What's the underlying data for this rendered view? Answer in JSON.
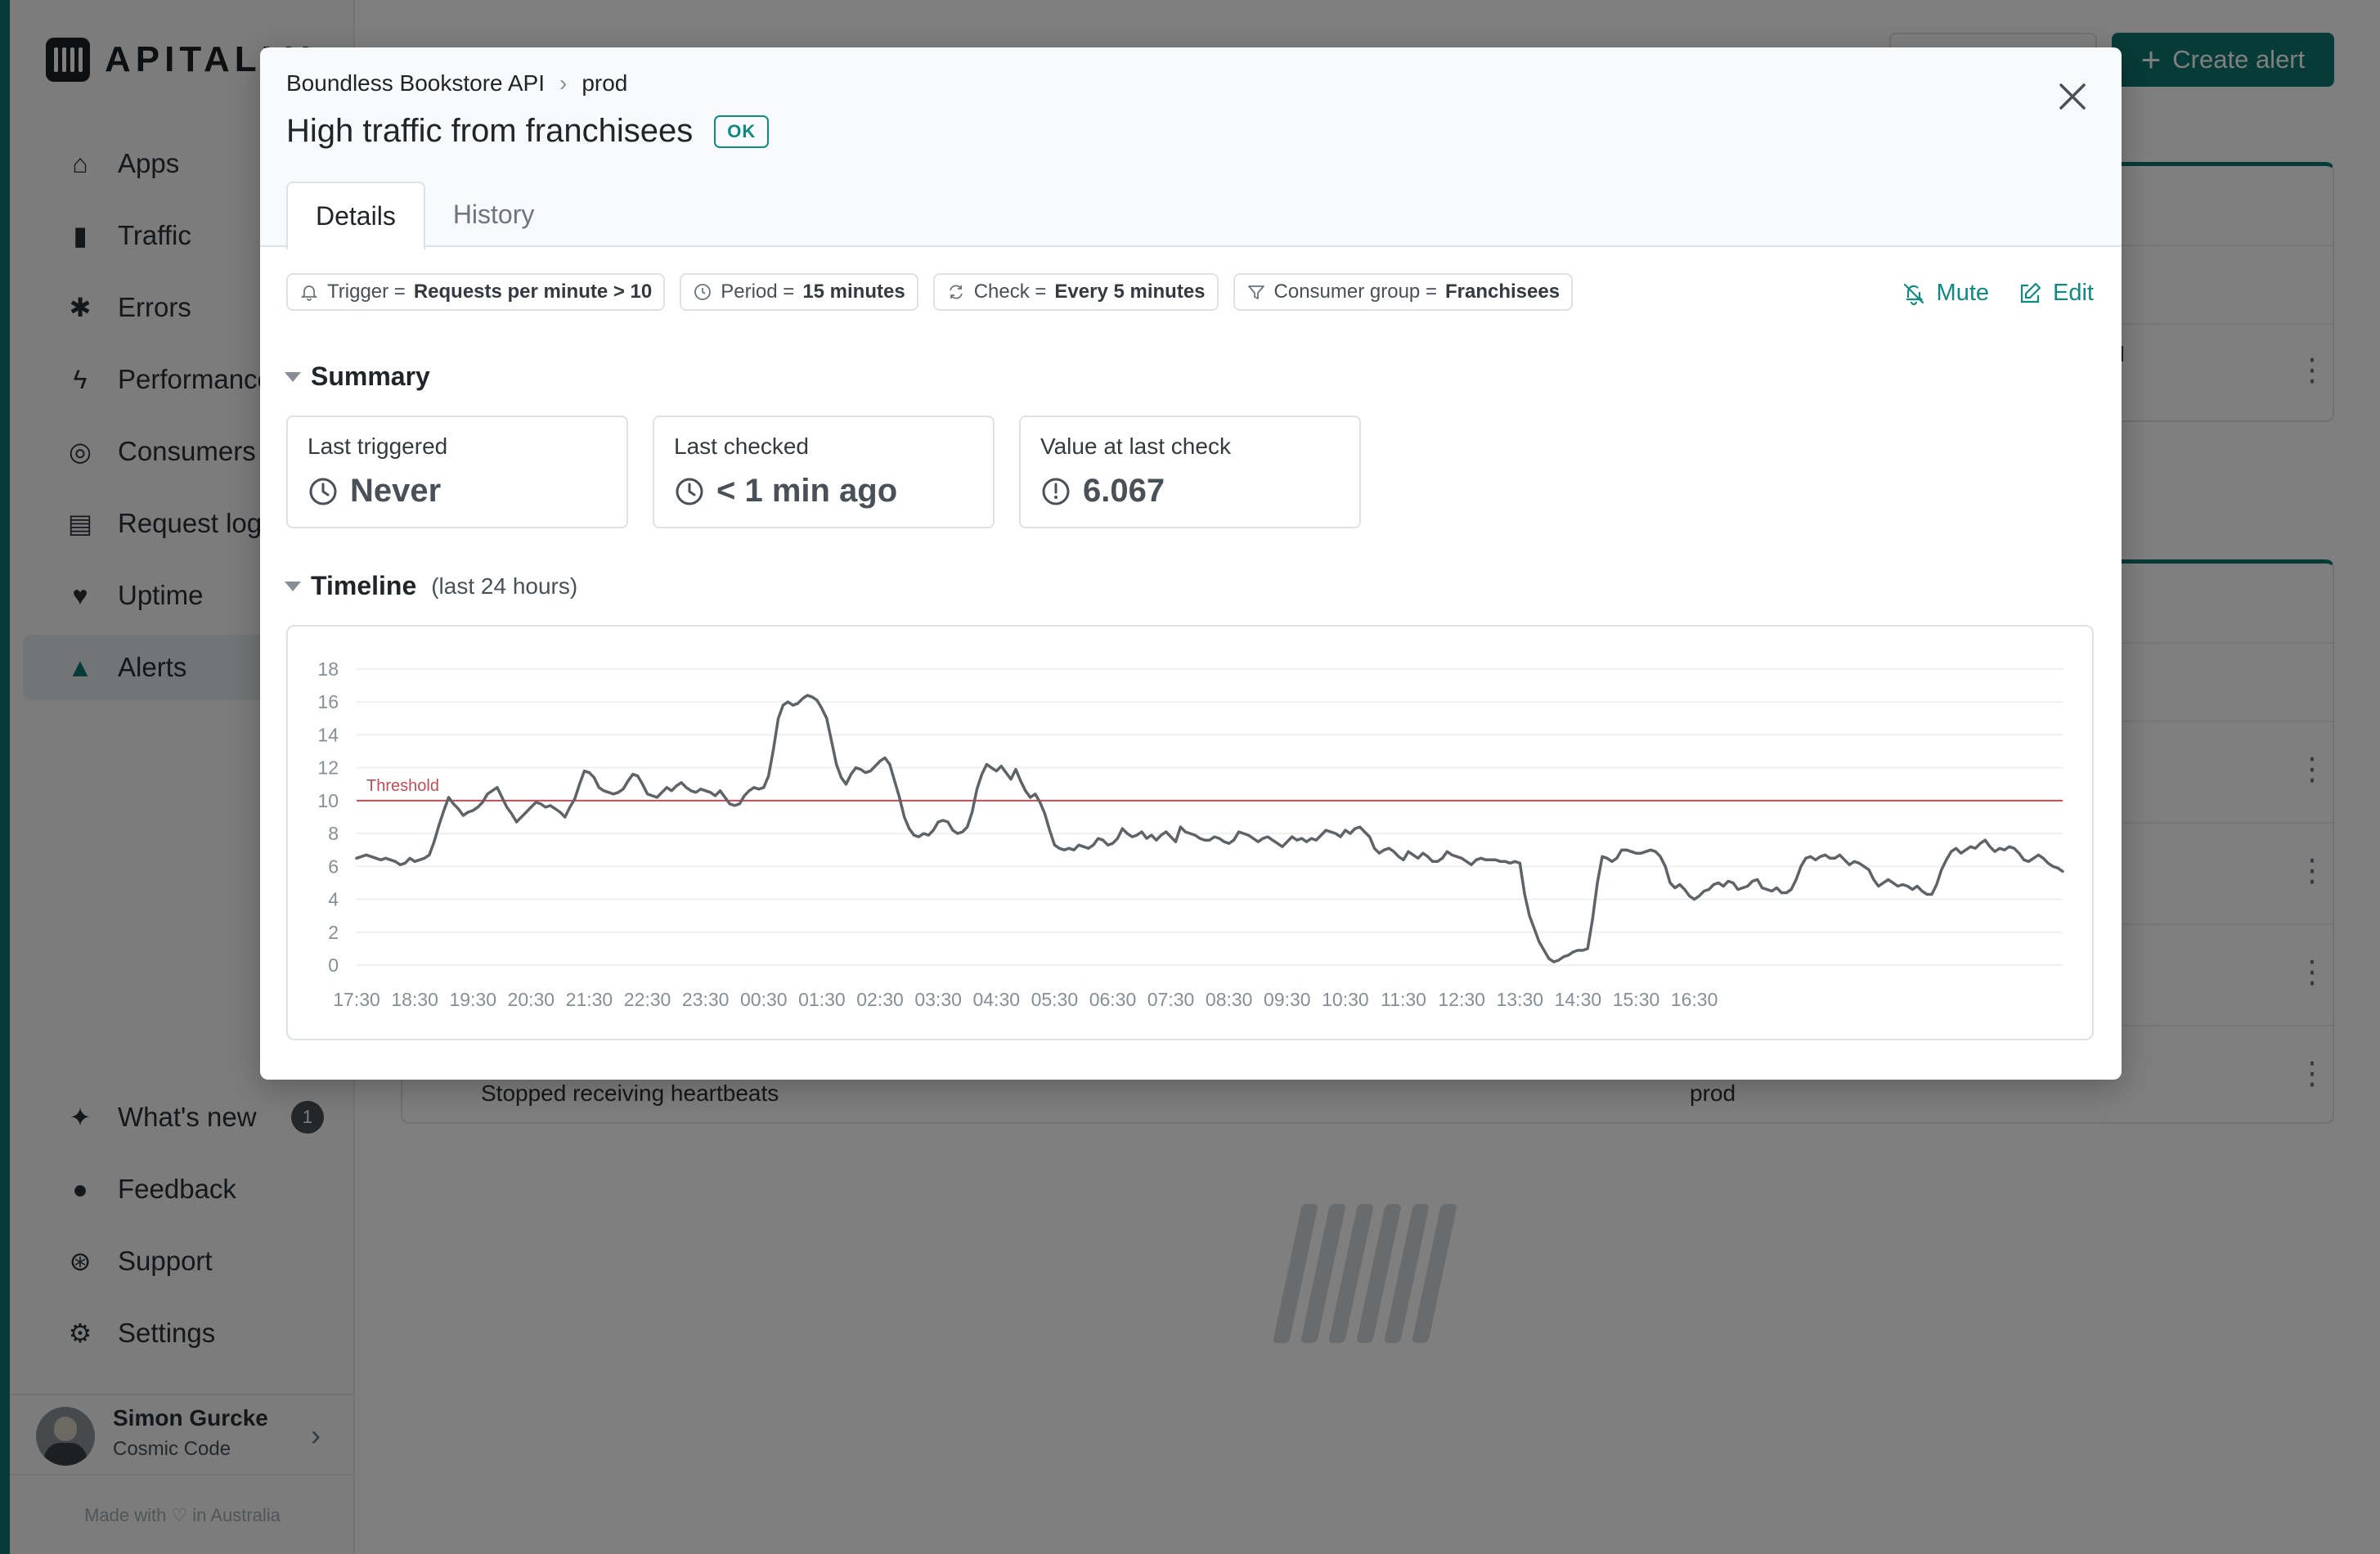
{
  "app": {
    "logo_text": "APITALLY",
    "nav": [
      {
        "label": "Apps",
        "icon": "home-icon"
      },
      {
        "label": "Traffic",
        "icon": "bar-chart-icon"
      },
      {
        "label": "Errors",
        "icon": "bug-icon"
      },
      {
        "label": "Performance",
        "icon": "bolt-icon"
      },
      {
        "label": "Consumers",
        "icon": "fingerprint-icon"
      },
      {
        "label": "Request log",
        "icon": "scroll-icon"
      },
      {
        "label": "Uptime",
        "icon": "heartbeat-icon"
      },
      {
        "label": "Alerts",
        "icon": "bell-icon"
      }
    ],
    "nav_bottom": [
      {
        "label": "What's new",
        "icon": "sparkles-icon",
        "badge": "1"
      },
      {
        "label": "Feedback",
        "icon": "chat-icon"
      },
      {
        "label": "Support",
        "icon": "lifebuoy-icon"
      },
      {
        "label": "Settings",
        "icon": "gear-icon"
      }
    ],
    "user": {
      "name": "Simon Gurcke",
      "org": "Cosmic Code"
    },
    "made_with": "Made with ♡ in Australia",
    "create_alert_label": "Create alert",
    "background_row_text": "Stopped receiving heartbeats",
    "background_row_env": "prod",
    "background_partial_text": "PI",
    "accent_color": "#0f766e"
  },
  "modal": {
    "breadcrumb": {
      "app": "Boundless Bookstore API",
      "env": "prod"
    },
    "title": "High traffic from franchisees",
    "status": "OK",
    "tabs": [
      "Details",
      "History"
    ],
    "conditions": [
      {
        "key": "Trigger = ",
        "value": "Requests per minute > 10",
        "icon": "bell-alert-icon"
      },
      {
        "key": "Period = ",
        "value": "15 minutes",
        "icon": "clock-icon"
      },
      {
        "key": "Check = ",
        "value": "Every 5 minutes",
        "icon": "refresh-icon"
      },
      {
        "key": "Consumer group = ",
        "value": "Franchisees",
        "icon": "filter-icon"
      }
    ],
    "actions": {
      "mute": "Mute",
      "edit": "Edit"
    },
    "summary": {
      "title": "Summary",
      "cards": [
        {
          "label": "Last triggered",
          "value": "Never",
          "icon": "clock-icon"
        },
        {
          "label": "Last checked",
          "value": "< 1 min ago",
          "icon": "clock-icon"
        },
        {
          "label": "Value at last check",
          "value": "6.067",
          "icon": "gauge-icon"
        }
      ]
    },
    "timeline": {
      "title": "Timeline",
      "subtitle": "(last 24 hours)"
    }
  },
  "chart_data": {
    "type": "line",
    "xlabel": "",
    "ylabel": "",
    "ylim": [
      0,
      18
    ],
    "yticks": [
      0,
      2,
      4,
      6,
      8,
      10,
      12,
      14,
      16,
      18
    ],
    "xticks": [
      "17:30",
      "18:30",
      "19:30",
      "20:30",
      "21:30",
      "22:30",
      "23:30",
      "00:30",
      "01:30",
      "02:30",
      "03:30",
      "04:30",
      "05:30",
      "06:30",
      "07:30",
      "08:30",
      "09:30",
      "10:30",
      "11:30",
      "12:30",
      "13:30",
      "14:30",
      "15:30",
      "16:30"
    ],
    "x_interval_minutes": 5,
    "threshold": {
      "label": "Threshold",
      "value": 10,
      "color": "#c44c57"
    },
    "grid": true,
    "series": [
      {
        "color": "#5f6368",
        "values": [
          6.5,
          6.6,
          6.7,
          6.6,
          6.5,
          6.4,
          6.5,
          6.4,
          6.3,
          6.1,
          6.2,
          6.5,
          6.3,
          6.4,
          6.5,
          6.7,
          7.5,
          8.5,
          9.4,
          10.2,
          9.8,
          9.5,
          9.1,
          9.3,
          9.4,
          9.6,
          9.9,
          10.4,
          10.6,
          10.8,
          10.2,
          9.6,
          9.2,
          8.7,
          9.0,
          9.3,
          9.6,
          9.9,
          9.8,
          9.6,
          9.7,
          9.5,
          9.3,
          9.0,
          9.6,
          10.1,
          11.0,
          11.8,
          11.7,
          11.4,
          10.8,
          10.6,
          10.5,
          10.4,
          10.5,
          10.7,
          11.2,
          11.6,
          11.5,
          11.0,
          10.4,
          10.3,
          10.2,
          10.5,
          10.8,
          10.6,
          10.9,
          11.1,
          10.8,
          10.6,
          10.5,
          10.7,
          10.6,
          10.5,
          10.3,
          10.6,
          10.2,
          9.8,
          9.7,
          9.8,
          10.3,
          10.6,
          10.8,
          10.7,
          10.8,
          11.5,
          13.1,
          15.0,
          15.8,
          16.0,
          15.8,
          15.9,
          16.2,
          16.4,
          16.3,
          16.1,
          15.6,
          15.0,
          13.6,
          12.2,
          11.4,
          11.0,
          11.6,
          12.0,
          11.9,
          11.7,
          11.8,
          12.1,
          12.4,
          12.6,
          12.2,
          11.2,
          10.2,
          9.0,
          8.3,
          7.9,
          7.8,
          8.0,
          7.9,
          8.2,
          8.7,
          8.8,
          8.7,
          8.2,
          8.0,
          8.1,
          8.4,
          9.3,
          10.7,
          11.6,
          12.2,
          12.0,
          11.8,
          12.1,
          11.7,
          11.3,
          11.9,
          11.2,
          10.6,
          10.2,
          10.4,
          9.9,
          9.2,
          8.2,
          7.3,
          7.1,
          7.0,
          7.1,
          7.0,
          7.3,
          7.2,
          7.1,
          7.3,
          7.7,
          7.6,
          7.3,
          7.4,
          7.7,
          8.3,
          8.0,
          7.8,
          7.9,
          8.1,
          7.7,
          7.9,
          7.6,
          7.9,
          8.1,
          7.8,
          7.5,
          8.4,
          8.1,
          8.0,
          7.9,
          7.7,
          7.6,
          7.6,
          7.8,
          7.7,
          7.5,
          7.4,
          7.6,
          8.1,
          8.0,
          7.9,
          7.7,
          7.5,
          7.7,
          7.8,
          7.6,
          7.4,
          7.2,
          7.5,
          7.8,
          7.6,
          7.7,
          7.5,
          7.7,
          7.6,
          7.9,
          8.2,
          8.1,
          8.0,
          7.8,
          8.2,
          8.0,
          8.3,
          8.4,
          8.1,
          7.8,
          7.1,
          6.8,
          7.0,
          7.1,
          6.9,
          6.6,
          6.4,
          6.9,
          6.7,
          6.5,
          6.8,
          6.6,
          6.3,
          6.3,
          6.5,
          6.9,
          6.7,
          6.6,
          6.5,
          6.3,
          6.1,
          6.4,
          6.5,
          6.4,
          6.4,
          6.4,
          6.3,
          6.3,
          6.2,
          6.3,
          6.2,
          4.3,
          3.0,
          2.2,
          1.4,
          0.9,
          0.4,
          0.2,
          0.3,
          0.5,
          0.6,
          0.8,
          0.9,
          0.9,
          1.0,
          2.8,
          5.0,
          6.6,
          6.5,
          6.3,
          6.5,
          7.0,
          7.0,
          6.9,
          6.8,
          6.8,
          6.9,
          7.0,
          6.9,
          6.6,
          6.0,
          5.0,
          4.7,
          4.9,
          4.6,
          4.2,
          4.0,
          4.2,
          4.5,
          4.6,
          4.9,
          5.0,
          4.8,
          5.1,
          5.0,
          4.6,
          4.7,
          4.8,
          5.1,
          5.2,
          4.7,
          4.6,
          4.5,
          4.7,
          4.4,
          4.4,
          4.6,
          5.2,
          6.0,
          6.5,
          6.6,
          6.4,
          6.6,
          6.7,
          6.5,
          6.5,
          6.7,
          6.4,
          6.1,
          6.3,
          6.2,
          6.0,
          5.8,
          5.2,
          4.8,
          5.0,
          5.2,
          5.0,
          4.8,
          4.9,
          4.8,
          4.6,
          4.8,
          4.5,
          4.3,
          4.3,
          4.9,
          5.8,
          6.4,
          6.9,
          7.1,
          6.8,
          7.0,
          7.2,
          7.1,
          7.4,
          7.6,
          7.2,
          6.9,
          7.1,
          7.0,
          7.2,
          7.1,
          6.8,
          6.4,
          6.3,
          6.5,
          6.7,
          6.5,
          6.2,
          6.0,
          5.9,
          5.7
        ]
      }
    ]
  }
}
